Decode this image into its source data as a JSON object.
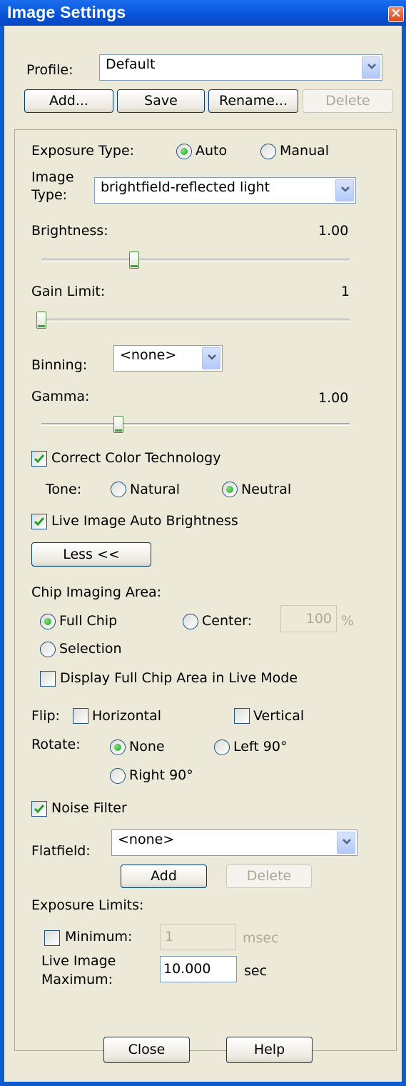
{
  "window": {
    "title": "Image Settings",
    "close_glyph": "×"
  },
  "profile": {
    "label": "Profile:",
    "value": "Default"
  },
  "profile_buttons": {
    "add": "Add...",
    "save": "Save",
    "rename": "Rename...",
    "delete": "Delete"
  },
  "exposure_type": {
    "label": "Exposure Type:",
    "auto": "Auto",
    "manual": "Manual",
    "selected": "Auto"
  },
  "image_type": {
    "label_line1": "Image",
    "label_line2": "Type:",
    "value": "brightfield-reflected light"
  },
  "brightness": {
    "label": "Brightness:",
    "value": "1.00",
    "level": 0.3
  },
  "gain_limit": {
    "label": "Gain Limit:",
    "value": "1",
    "level": 0.0
  },
  "binning": {
    "label": "Binning:",
    "value": "<none>"
  },
  "gamma": {
    "label": "Gamma:",
    "value": "1.00",
    "level": 0.25
  },
  "correct_color": {
    "label": "Correct Color Technology",
    "checked": true
  },
  "tone": {
    "label": "Tone:",
    "natural": "Natural",
    "neutral": "Neutral",
    "selected": "Neutral"
  },
  "live_auto_brightness": {
    "label": "Live Image Auto Brightness",
    "checked": true
  },
  "less_button": "Less <<",
  "chip_area": {
    "label": "Chip Imaging Area:",
    "full_chip": "Full Chip",
    "center": "Center:",
    "center_value": "100",
    "percent": "%",
    "selection": "Selection",
    "selected": "Full Chip"
  },
  "display_full_chip": {
    "label": "Display Full Chip Area in Live Mode",
    "checked": false
  },
  "flip": {
    "label": "Flip:",
    "horizontal": "Horizontal",
    "vertical": "Vertical"
  },
  "rotate": {
    "label": "Rotate:",
    "none": "None",
    "left": "Left 90°",
    "right": "Right 90°",
    "selected": "None"
  },
  "noise_filter": {
    "label": "Noise Filter",
    "checked": true
  },
  "flatfield": {
    "label": "Flatfield:",
    "value": "<none>",
    "add": "Add",
    "delete": "Delete"
  },
  "exposure_limits": {
    "label": "Exposure Limits:",
    "minimum_label": "Minimum:",
    "minimum_value": "1",
    "minimum_unit": "msec",
    "live_label_line1": "Live Image",
    "live_label_line2": "Maximum:",
    "maximum_value": "10.000",
    "maximum_unit": "sec"
  },
  "footer": {
    "close": "Close",
    "help": "Help"
  },
  "colors": {
    "titlebar": "#0a5ccf",
    "dialog_bg": "#ece9d8",
    "radio_on": "#21a121",
    "check_mark": "#21a121"
  },
  "icons": {
    "close": "close-icon",
    "dropdown": "chevron-down-icon",
    "check": "checkmark-icon"
  }
}
